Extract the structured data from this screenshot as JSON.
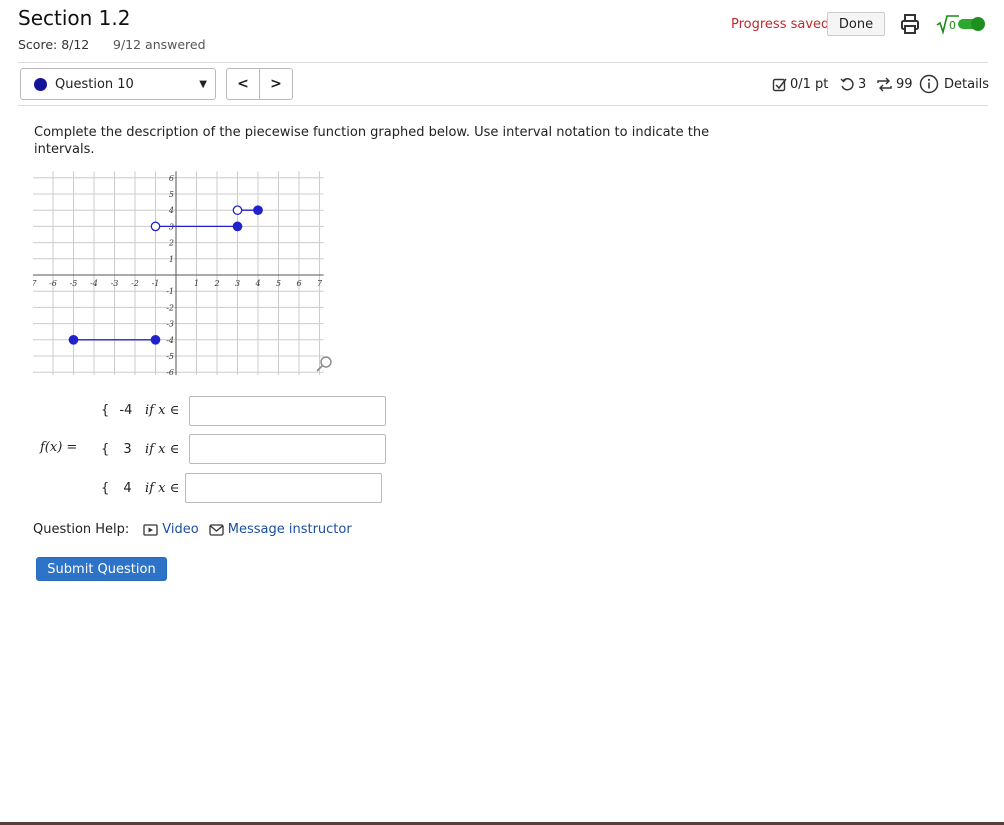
{
  "header": {
    "title": "Section 1.2",
    "score": "Score: 8/12",
    "answered": "9/12 answered",
    "progress_status": "Progress saved",
    "done_label": "Done"
  },
  "question_nav": {
    "selected": "Question 10",
    "prev_label": "<",
    "next_label": ">"
  },
  "question_meta": {
    "points": "0/1 pt",
    "retries": "3",
    "attempts": "99",
    "details_label": "Details"
  },
  "prompt": "Complete the description of the piecewise function graphed below. Use interval notation to indicate the intervals.",
  "graph": {
    "x_ticks": [
      "-7",
      "-6",
      "-5",
      "-4",
      "-3",
      "-2",
      "-1",
      "1",
      "2",
      "3",
      "4",
      "5",
      "6",
      "7"
    ],
    "y_ticks": [
      "6",
      "5",
      "4",
      "3",
      "2",
      "1",
      "-1",
      "-2",
      "-3",
      "-4",
      "-5",
      "-6"
    ],
    "segments": [
      {
        "y": -4,
        "x_start": -5,
        "x_end": -1,
        "start_closed": true,
        "end_closed": true
      },
      {
        "y": 3,
        "x_start": -1,
        "x_end": 3,
        "start_closed": false,
        "end_closed": true
      },
      {
        "y": 4,
        "x_start": 3,
        "x_end": 4,
        "start_closed": false,
        "end_closed": true
      }
    ],
    "colors": {
      "line": "#2222cc",
      "grid": "#cccccc"
    }
  },
  "equation": {
    "lhs": "f(x) =",
    "rows": [
      {
        "brace": "{",
        "value": "-4",
        "cond": "if x ∈",
        "input_value": ""
      },
      {
        "brace": "{",
        "value": "3",
        "cond": "if x ∈",
        "input_value": ""
      },
      {
        "brace": "{",
        "value": "4",
        "cond": "if x ∈",
        "input_value": ""
      }
    ]
  },
  "help": {
    "label": "Question Help:",
    "video": "Video",
    "message": "Message instructor"
  },
  "submit_label": "Submit Question"
}
